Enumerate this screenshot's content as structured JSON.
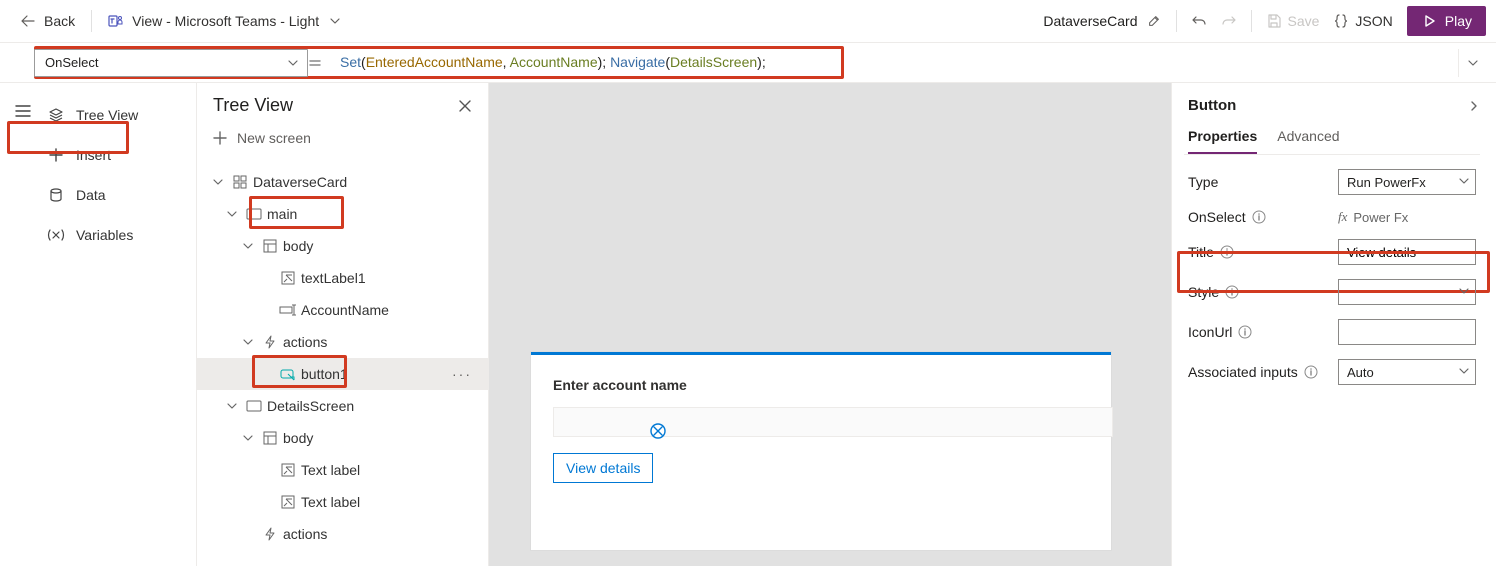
{
  "toolbar": {
    "back_label": "Back",
    "view_label": "View - Microsoft Teams - Light",
    "app_name": "DataverseCard",
    "save_label": "Save",
    "json_label": "JSON",
    "play_label": "Play"
  },
  "formula": {
    "property": "OnSelect",
    "tokens": {
      "set": "Set",
      "arg1": "EnteredAccountName",
      "arg2": "AccountName",
      "nav": "Navigate",
      "navarg": "DetailsScreen"
    },
    "raw": "Set(EnteredAccountName, AccountName); Navigate(DetailsScreen);"
  },
  "leftnav": {
    "items": [
      "Tree View",
      "Insert",
      "Data",
      "Variables"
    ]
  },
  "tree": {
    "title": "Tree View",
    "new_screen": "New screen",
    "nodes": {
      "dataverse": "DataverseCard",
      "main": "main",
      "body": "body",
      "textLabel1": "textLabel1",
      "accountName": "AccountName",
      "actions": "actions",
      "button1": "button1",
      "details": "DetailsScreen",
      "body2": "body",
      "textlabel_a": "Text label",
      "textlabel_b": "Text label",
      "actions2": "actions"
    }
  },
  "card": {
    "label": "Enter account name",
    "btn": "View details"
  },
  "props": {
    "panel_title": "Button",
    "tab_props": "Properties",
    "tab_adv": "Advanced",
    "rows": {
      "type": {
        "label": "Type",
        "value": "Run PowerFx"
      },
      "onselect": {
        "label": "OnSelect",
        "value": "Power Fx"
      },
      "title": {
        "label": "Title",
        "value": "View details"
      },
      "style": {
        "label": "Style",
        "value": ""
      },
      "iconurl": {
        "label": "IconUrl",
        "value": ""
      },
      "assoc": {
        "label": "Associated inputs",
        "value": "Auto"
      }
    }
  }
}
